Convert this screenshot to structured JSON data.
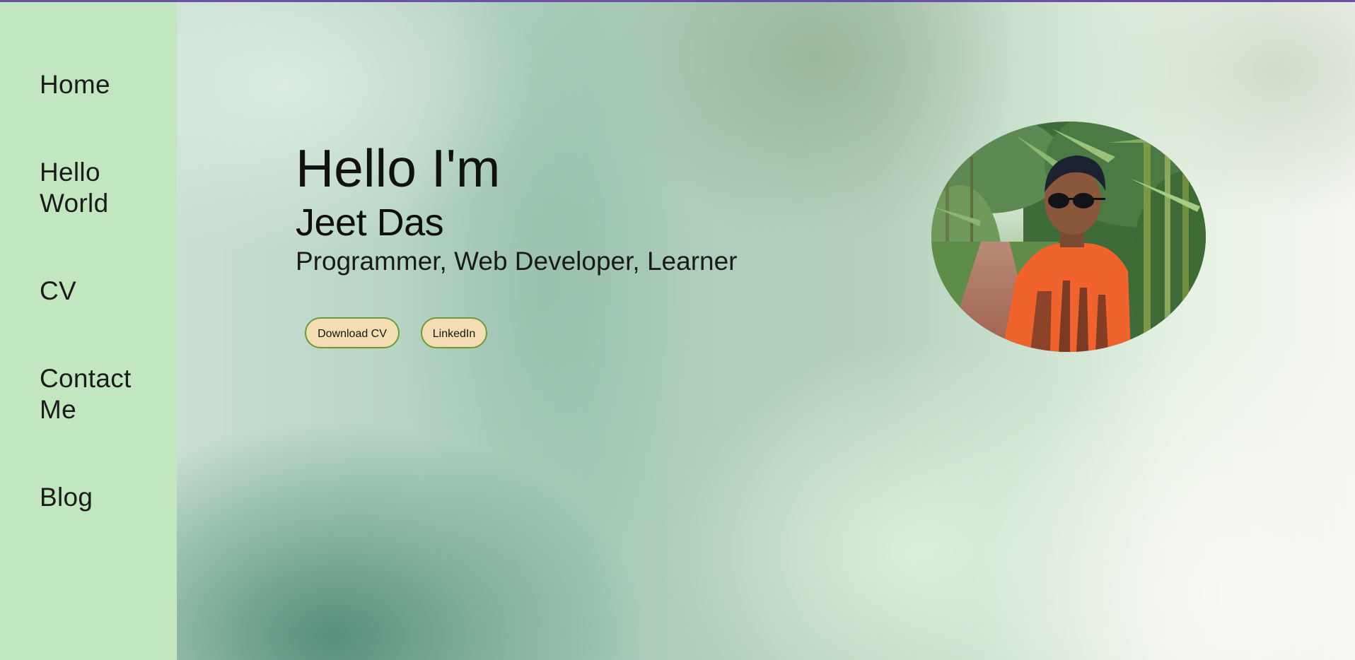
{
  "sidebar": {
    "items": [
      {
        "label": "Home"
      },
      {
        "label": "Hello World"
      },
      {
        "label": "CV"
      },
      {
        "label": "Contact Me"
      },
      {
        "label": "Blog"
      }
    ]
  },
  "hero": {
    "greeting": "Hello I'm",
    "name": "Jeet Das",
    "roles": "Programmer, Web Developer, Learner",
    "buttons": {
      "download_cv": "Download CV",
      "linkedin": "LinkedIn"
    }
  },
  "colors": {
    "top_accent": "#6f4fa8",
    "sidebar_bg": "#c2e6bf",
    "button_bg": "#f4ddb2",
    "button_border": "#6d9a39"
  }
}
